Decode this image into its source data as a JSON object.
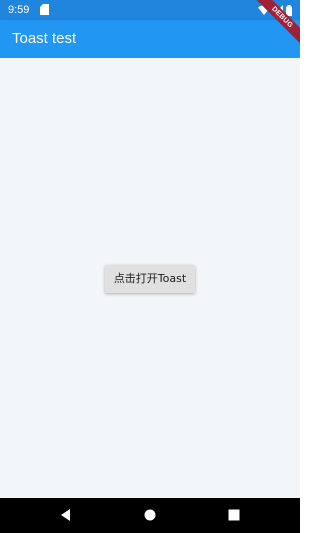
{
  "status_bar": {
    "time": "9:59",
    "icons": [
      "sd-card-icon",
      "wifi-icon",
      "signal-icon",
      "battery-icon"
    ]
  },
  "app_bar": {
    "title": "Toast test",
    "debug_banner": "DEBUG"
  },
  "main": {
    "button_label": "点击打开Toast"
  },
  "nav_bar": {
    "buttons": [
      "back-icon",
      "home-icon",
      "recents-icon"
    ]
  },
  "colors": {
    "primary": "#2196f3",
    "status_bar": "#1f85dd",
    "background": "#f3f6f9",
    "debug_banner": "#9e2138"
  }
}
